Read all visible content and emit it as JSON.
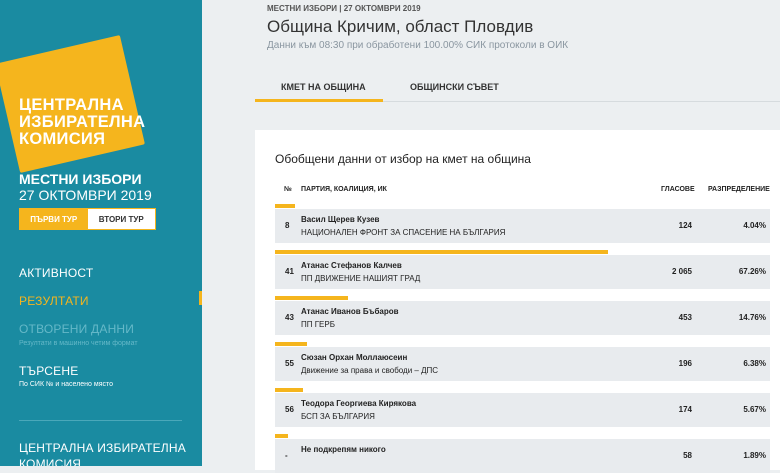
{
  "sidebar": {
    "logo_line1": "ЦЕНТРАЛНА",
    "logo_line2": "ИЗБИРАТЕЛНА",
    "logo_line3": "КОМИСИЯ",
    "election_title": "МЕСТНИ ИЗБОРИ",
    "election_date": "27 ОКТОМВРИ 2019",
    "round1": "ПЪРВИ ТУР",
    "round2": "ВТОРИ ТУР",
    "nav": {
      "activity": "АКТИВНОСТ",
      "results": "РЕЗУЛТАТИ",
      "open_data": "ОТВОРЕНИ ДАННИ",
      "open_data_sub": "Резултати в машинно четим формат",
      "search": "ТЪРСЕНЕ",
      "search_sub": "По СИК № и населено място"
    },
    "footer_line1": "ЦЕНТРАЛНА ИЗБИРАТЕЛНА",
    "footer_line2": "КОМИСИЯ"
  },
  "header": {
    "small": "МЕСТНИ ИЗБОРИ | 27 ОКТОМВРИ 2019",
    "title": "Община Кричим, област Пловдив",
    "subtitle": "Данни към 08:30 при обработени 100.00% СИК протоколи в ОИК"
  },
  "tabs": [
    "КМЕТ НА ОБЩИНА",
    "ОБЩИНСКИ СЪВЕТ"
  ],
  "results": {
    "title": "Обобщени данни от избор на кмет на община",
    "columns": {
      "num": "№",
      "party": "ПАРТИЯ, КОАЛИЦИЯ, ИК",
      "votes": "ГЛАСОВЕ",
      "share": "РАЗПРЕДЕЛЕНИЕ"
    },
    "rows": [
      {
        "num": "8",
        "name": "Васил Щерев Кузев",
        "party": "НАЦИОНАЛЕН ФРОНТ ЗА СПАСЕНИЕ НА БЪЛГАРИЯ",
        "votes": "124",
        "share": "4.04%",
        "share_value": 4.04
      },
      {
        "num": "41",
        "name": "Атанас Стефанов Калчев",
        "party": "ПП ДВИЖЕНИЕ НАШИЯТ ГРАД",
        "votes": "2 065",
        "share": "67.26%",
        "share_value": 67.26
      },
      {
        "num": "43",
        "name": "Атанас Иванов Бъбаров",
        "party": "ПП ГЕРБ",
        "votes": "453",
        "share": "14.76%",
        "share_value": 14.76
      },
      {
        "num": "55",
        "name": "Сюзан Орхан Моллаюсеин",
        "party": "Движение за права и свободи – ДПС",
        "votes": "196",
        "share": "6.38%",
        "share_value": 6.38
      },
      {
        "num": "56",
        "name": "Теодора Георгиева Кирякова",
        "party": "БСП ЗА БЪЛГАРИЯ",
        "votes": "174",
        "share": "5.67%",
        "share_value": 5.67
      },
      {
        "num": "-",
        "name": "Не подкрепям никого",
        "party": "",
        "votes": "58",
        "share": "1.89%",
        "share_value": 1.89
      }
    ]
  },
  "colors": {
    "accent": "#f5b51d",
    "sidebar": "#1a8ba1",
    "row_bg": "#e8ebee"
  }
}
